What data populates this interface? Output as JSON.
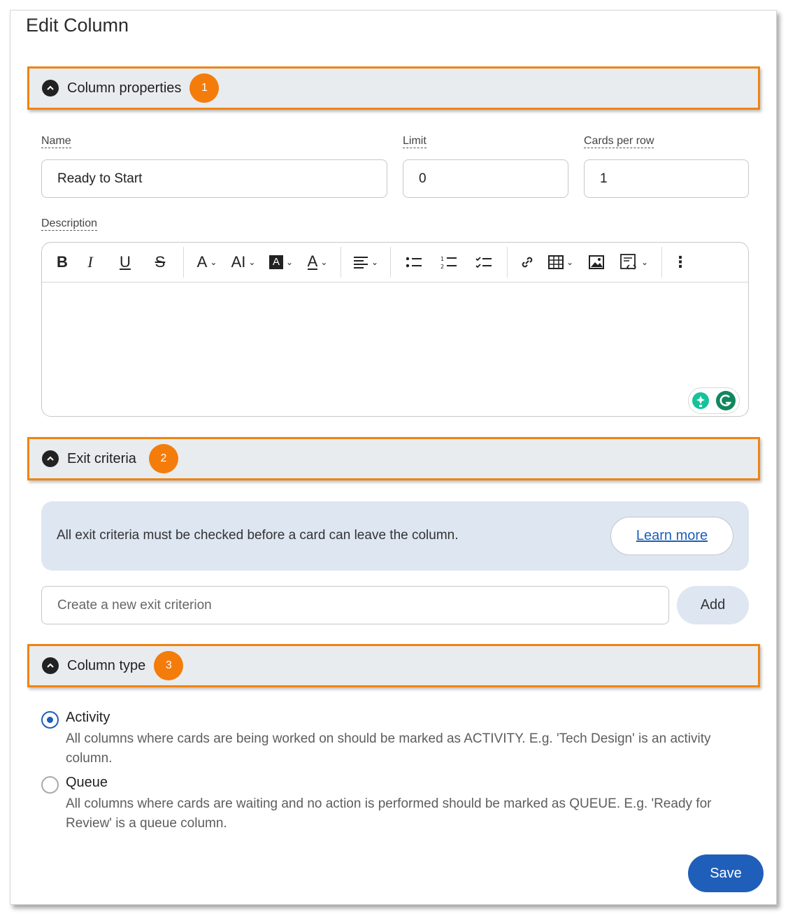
{
  "dialog": {
    "title": "Edit Column",
    "accent_color": "#1f5fb9",
    "highlight_color": "#f0840f"
  },
  "sections": {
    "properties": {
      "label": "Column properties",
      "callout": "1"
    },
    "exit": {
      "label": "Exit criteria",
      "callout": "2"
    },
    "type": {
      "label": "Column type",
      "callout": "3"
    }
  },
  "fields": {
    "name": {
      "label": "Name",
      "value": "Ready to Start"
    },
    "limit": {
      "label": "Limit",
      "value": "0"
    },
    "cards_per_row": {
      "label": "Cards per row",
      "value": "1"
    },
    "description": {
      "label": "Description",
      "value": ""
    }
  },
  "toolbar_icons": [
    "bold-icon",
    "italic-icon",
    "underline-icon",
    "strikethrough-icon",
    "font-style-icon",
    "font-size-icon",
    "highlight-color-icon",
    "text-color-icon",
    "align-icon",
    "bullet-list-icon",
    "numbered-list-icon",
    "checklist-icon",
    "link-icon",
    "table-icon",
    "image-icon",
    "code-snippet-icon",
    "more-icon"
  ],
  "exit_criteria": {
    "info_text": "All exit criteria must be checked before a card can leave the column.",
    "learn_more": "Learn more",
    "new_placeholder": "Create a new exit criterion",
    "add_label": "Add"
  },
  "column_type": {
    "options": [
      {
        "label": "Activity",
        "description": "All columns where cards are being worked on should be marked as ACTIVITY. E.g. 'Tech Design' is an activity column.",
        "selected": true
      },
      {
        "label": "Queue",
        "description": "All columns where cards are waiting and no action is performed should be marked as QUEUE. E.g. 'Ready for Review' is a queue column.",
        "selected": false
      }
    ]
  },
  "footer": {
    "save_label": "Save"
  }
}
